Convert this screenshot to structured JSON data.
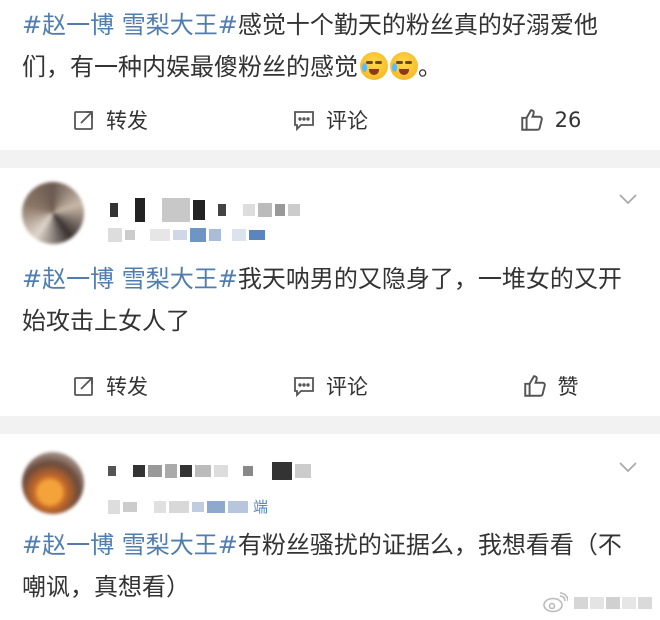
{
  "post1": {
    "tag": "#赵一博 雪梨大王#",
    "text": "感觉十个勤天的粉丝真的好溺爱他们，有一种内娱最傻粉丝的感觉",
    "tail": "。",
    "emoji": "crying-laugh-emoji",
    "actions": {
      "repost": "转发",
      "comment": "评论",
      "like": "26"
    }
  },
  "post2": {
    "tag": "#赵一博 雪梨大王#",
    "text": "我天呐男的又隐身了，一堆女的又开始攻击上女人了",
    "actions": {
      "repost": "转发",
      "comment": "评论",
      "like": "赞"
    }
  },
  "post3": {
    "tag": "#赵一博 雪梨大王#",
    "text": "有粉丝骚扰的证据么，我想看看（不嘲讽，真想看）",
    "source_fragment": "端"
  },
  "colors": {
    "link": "#507daf",
    "text": "#333333",
    "icon": "#555555",
    "background": "#f2f2f2"
  },
  "icons": [
    "repost-icon",
    "comment-icon",
    "like-icon",
    "chevron-down-icon",
    "weibo-logo-icon"
  ]
}
